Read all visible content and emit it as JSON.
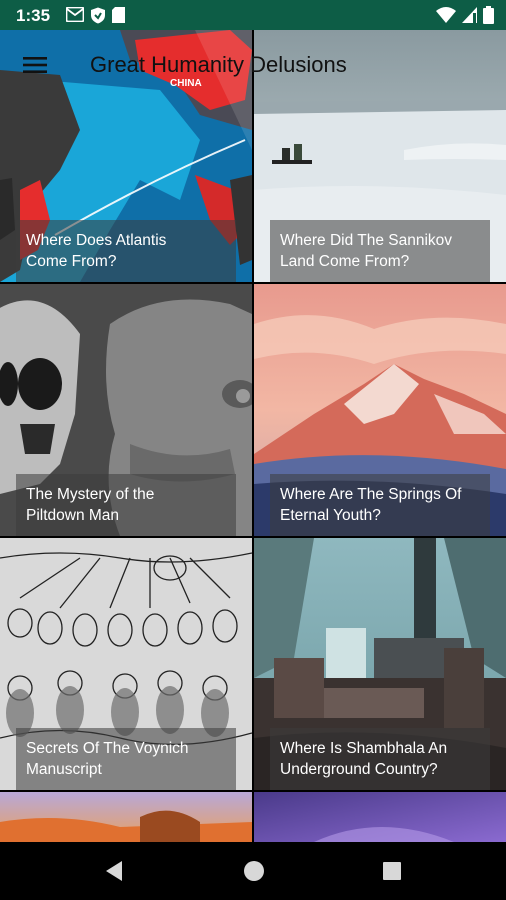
{
  "status_bar": {
    "time": "1:35",
    "icons_left": [
      "gmail-icon",
      "shield-icon",
      "sd-card-icon"
    ],
    "icons_right": [
      "wifi-icon",
      "signal-icon",
      "battery-icon"
    ]
  },
  "toolbar": {
    "title": "Great Humanity Delusions",
    "menu_icon": "menu-icon"
  },
  "articles": [
    {
      "title": "Where Does Atlantis Come From?",
      "line1": "Where Does Atlantis",
      "line2": "Come From?"
    },
    {
      "title": "Where Did The Sannikov Land Come From?",
      "line1": "Where Did The Sannikov",
      "line2": "Land Come From?"
    },
    {
      "title": "The Mystery of the Piltdown Man",
      "line1": "The Mystery of the",
      "line2": "Piltdown Man"
    },
    {
      "title": "Where Are The Springs Of Eternal Youth?",
      "line1": "Where Are The Springs Of",
      "line2": "Eternal Youth?"
    },
    {
      "title": "Secrets Of The Voynich Manuscript",
      "line1": "Secrets Of The Voynich",
      "line2": "Manuscript"
    },
    {
      "title": "Where Is Shambhala An Underground Country?",
      "line1": "Where Is Shambhala An",
      "line2": "Underground Country?"
    }
  ],
  "map_label": "CHINA",
  "colors": {
    "status_bar": "#0d5d46",
    "caption_bg": "rgba(60,60,60,0.55)"
  }
}
